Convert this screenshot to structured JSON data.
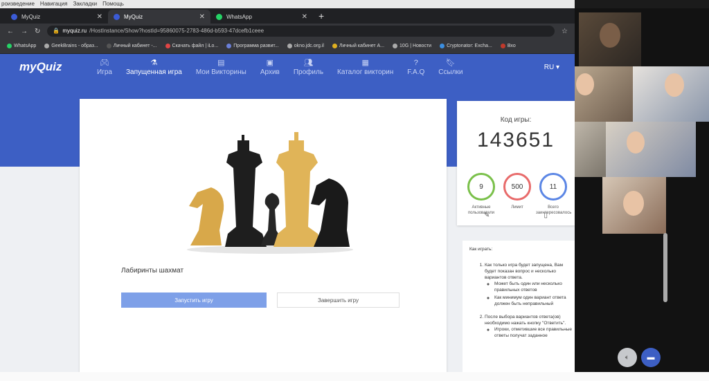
{
  "os_menu": [
    "роизведение",
    "Навигация",
    "Закладки",
    "Помощь"
  ],
  "browser": {
    "tabs": [
      {
        "title": "MyQuiz",
        "active": false,
        "icon": "myquiz-favicon"
      },
      {
        "title": "MyQuiz",
        "active": true,
        "icon": "myquiz-favicon"
      },
      {
        "title": "WhatsApp",
        "active": false,
        "icon": "whatsapp-favicon"
      }
    ],
    "url_host": "myquiz.ru",
    "url_path": "/HostInstance/Show?hostId=95860075-2783-486d-b593-47dcefb1ceee",
    "bookmarks": [
      "WhatsApp",
      "GeekBrains - образ...",
      "Личный кабинет -...",
      "Скачать файл | iLo...",
      "Программа развит...",
      "okno.jdc.org.il",
      "Личный кабинет A...",
      "10G | Новости",
      "Cryptonator: Excha...",
      "Вхо"
    ]
  },
  "nav": {
    "logo": "myQuiz",
    "items": [
      {
        "label": "Игра",
        "icon": "gamepad-icon",
        "active": false
      },
      {
        "label": "Запущенная игра",
        "icon": "flask-icon",
        "active": true
      },
      {
        "label": "Мои Викторины",
        "icon": "list-icon",
        "active": false
      },
      {
        "label": "Архив",
        "icon": "archive-icon",
        "active": false
      },
      {
        "label": "Профиль",
        "icon": "users-icon",
        "active": false
      },
      {
        "label": "Каталог викторин",
        "icon": "grid-icon",
        "active": false
      },
      {
        "label": "F.A.Q",
        "icon": "question-icon",
        "active": false
      },
      {
        "label": "Ссылки",
        "icon": "bookmark-icon",
        "active": false
      }
    ],
    "language": "RU"
  },
  "game": {
    "title": "Лабиринты шахмат",
    "start_label": "Запустить игру",
    "end_label": "Завершить игру"
  },
  "sidebar": {
    "code_label": "Код игры:",
    "code": "143651",
    "stats": [
      {
        "value": "9",
        "label": "Активные пользователи",
        "color": "#7ac04a"
      },
      {
        "value": "500",
        "label": "Лимит",
        "color": "#e86b6b"
      },
      {
        "value": "11",
        "label": "Всего заинтересовалось",
        "color": "#5b86e5"
      }
    ]
  },
  "howto": {
    "heading": "Как играть:",
    "step1": "Как только игра будет запущена, Вам будет показан вопрос и несколько вариантов ответа.",
    "step1_bullets": [
      "Может быть один или несколько правильных ответов",
      "Как минимум один вариант ответа должен быть неправильный"
    ],
    "step2": "После выбора вариантов ответа(ов) необходимо нажать кнопку \"Ответить\".",
    "step2_bullets": [
      "Игроки, отметившие все правильные ответы получат заданное"
    ]
  }
}
